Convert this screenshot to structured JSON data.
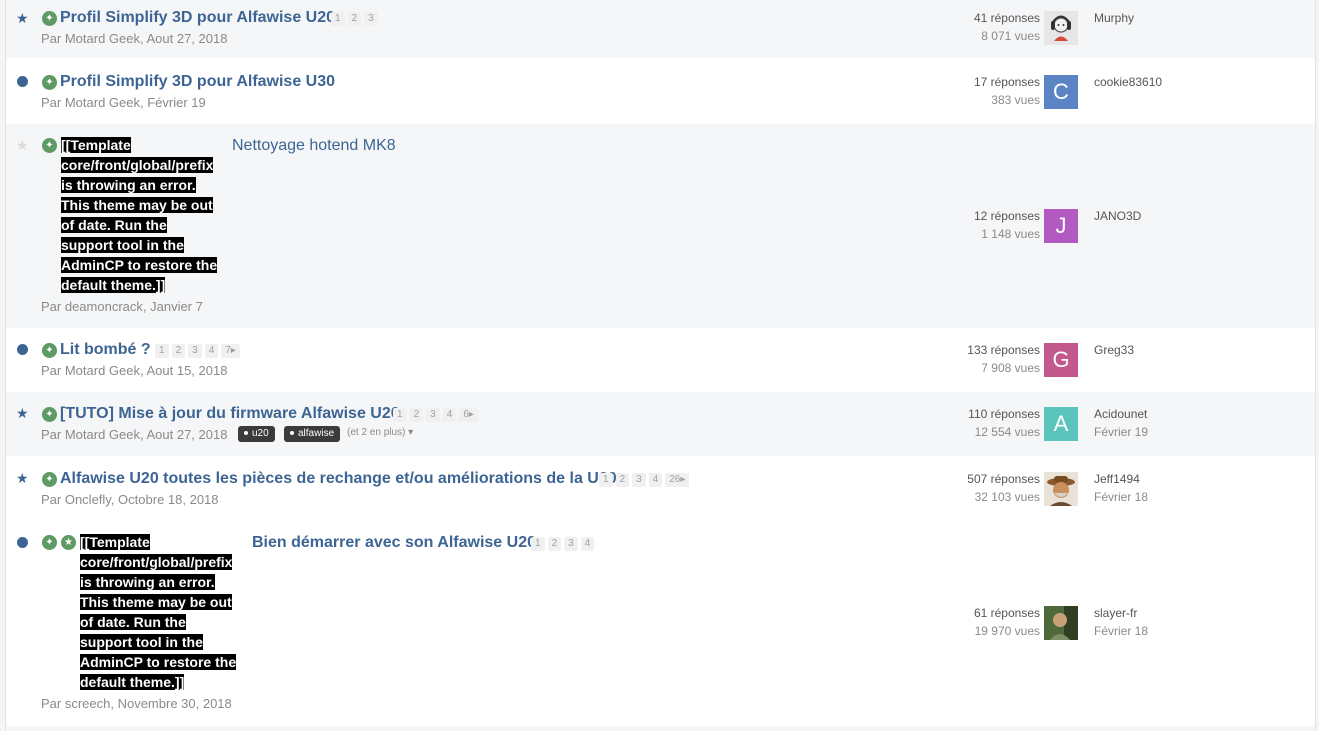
{
  "topics": [
    {
      "title": "Profil Simplify 3D pour Alfawise U20",
      "pages": [
        "1",
        "2",
        "3"
      ],
      "meta": "Par Motard Geek, Aout 27, 2018",
      "replies": "41 réponses",
      "views": "8 071 vues",
      "last_user": "Murphy",
      "last_date": "",
      "avatar_letter": "",
      "avatar_color": "#d9d9d9",
      "marker": "star-icon"
    },
    {
      "title": "Profil Simplify 3D pour Alfawise U30",
      "pages": [],
      "meta": "Par Motard Geek, Février 19",
      "replies": "17 réponses",
      "views": "383 vues",
      "last_user": "cookie83610",
      "last_date": "",
      "avatar_letter": "C",
      "avatar_color": "#5b84c4",
      "marker": "unread-dot-icon"
    },
    {
      "title": "Nettoyage hotend MK8",
      "pages": [],
      "meta": "Par deamoncrack, Janvier 7",
      "replies": "12 réponses",
      "views": "1 148 vues",
      "last_user": "JANO3D",
      "last_date": "",
      "avatar_letter": "J",
      "avatar_color": "#b35ac2",
      "marker": "star-icon",
      "error_lines": [
        "[[Template",
        "core/front/global/prefix",
        "is throwing an error.",
        "This theme may be out",
        "of date. Run the",
        "support tool in the",
        "AdminCP to restore the",
        "default theme.]]"
      ]
    },
    {
      "title": "Lit bombé ?",
      "pages": [
        "1",
        "2",
        "3",
        "4",
        "7▸"
      ],
      "meta": "Par Motard Geek, Aout 15, 2018",
      "replies": "133 réponses",
      "views": "7 908 vues",
      "last_user": "Greg33",
      "last_date": "",
      "avatar_letter": "G",
      "avatar_color": "#c2588b",
      "marker": "unread-dot-icon"
    },
    {
      "title": "[TUTO] Mise à jour du firmware Alfawise U20",
      "pages": [
        "1",
        "2",
        "3",
        "4",
        "6▸"
      ],
      "meta": "Par Motard Geek, Aout 27, 2018",
      "tags": [
        "u20",
        "alfawise"
      ],
      "more_tags": "(et 2 en plus) ▾",
      "replies": "110 réponses",
      "views": "12 554 vues",
      "last_user": "Acidounet",
      "last_date": "Février 19",
      "avatar_letter": "A",
      "avatar_color": "#5bc4bc",
      "marker": "star-icon"
    },
    {
      "title": "Alfawise U20 toutes les pièces de rechange et/ou améliorations de la U20",
      "pages": [
        "1",
        "2",
        "3",
        "4",
        "26▸"
      ],
      "meta": "Par Onclefly, Octobre 18, 2018",
      "replies": "507 réponses",
      "views": "32 103 vues",
      "last_user": "Jeff1494",
      "last_date": "Février 18",
      "avatar_letter": "",
      "avatar_color": "#b08660",
      "marker": "star-icon"
    },
    {
      "title": "Bien démarrer avec son Alfawise U20",
      "pages": [
        "1",
        "2",
        "3",
        "4"
      ],
      "meta": "Par screech, Novembre 30, 2018",
      "replies": "61 réponses",
      "views": "19 970 vues",
      "last_user": "slayer-fr",
      "last_date": "Février 18",
      "avatar_letter": "",
      "avatar_color": "#6b7a52",
      "marker": "unread-dot-icon",
      "error_lines": [
        "[[Template",
        "core/front/global/prefix",
        "is throwing an error.",
        "This theme may be out",
        "of date. Run the",
        "support tool in the",
        "AdminCP to restore the",
        "default theme.]]"
      ]
    }
  ]
}
